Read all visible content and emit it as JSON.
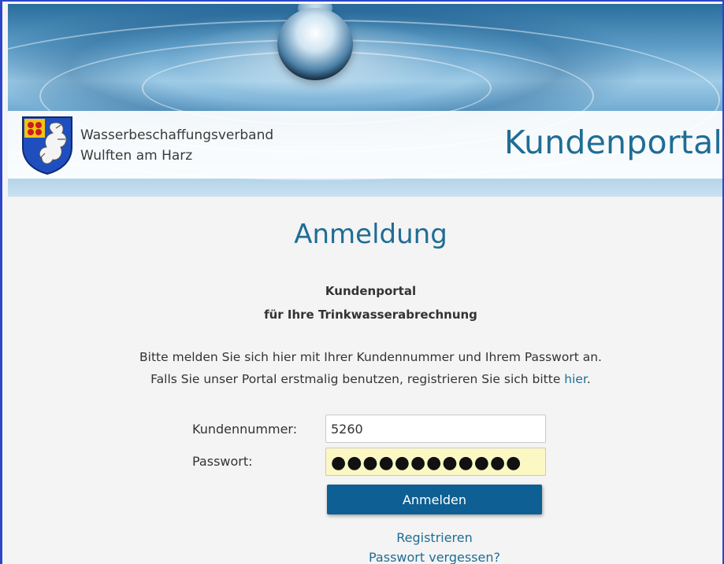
{
  "header": {
    "org_line1": "Wasserbeschaffungsverband",
    "org_line2": "Wulften am Harz",
    "portal_title": "Kundenportal"
  },
  "main": {
    "heading": "Anmeldung",
    "subtitle_line1": "Kundenportal",
    "subtitle_line2": "für Ihre Trinkwasserabrechnung",
    "info_line1": "Bitte melden Sie sich hier mit Ihrer Kundennummer und Ihrem Passwort an.",
    "info_line2_prefix": "Falls Sie unser Portal erstmalig benutzen, registrieren Sie sich bitte ",
    "info_line2_link": "hier",
    "info_line2_suffix": "."
  },
  "form": {
    "customer_number_label": "Kundennummer:",
    "customer_number_value": "5260",
    "password_label": "Passwort:",
    "password_mask": "●●●●●●●●●●●●",
    "submit_label": "Anmelden"
  },
  "links": {
    "register": "Registrieren",
    "forgot_password": "Passwort vergessen?"
  },
  "colors": {
    "accent": "#1f6d94",
    "button": "#0e5f93",
    "autofill": "#fcf8c4",
    "frame": "#2c46c8"
  }
}
